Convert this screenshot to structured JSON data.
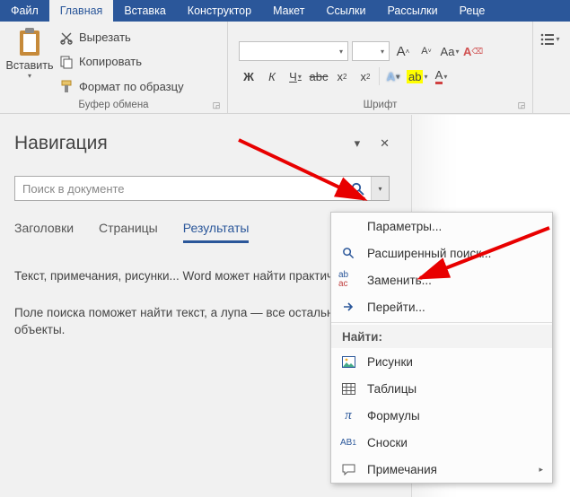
{
  "tabs": {
    "file": "Файл",
    "home": "Главная",
    "insert": "Вставка",
    "design": "Конструктор",
    "layout": "Макет",
    "refs": "Ссылки",
    "mail": "Рассылки",
    "review": "Реце"
  },
  "ribbon": {
    "clipboard": {
      "paste": "Вставить",
      "cut": "Вырезать",
      "copy": "Копировать",
      "format_painter": "Формат по образцу",
      "group_label": "Буфер обмена"
    },
    "font": {
      "group_label": "Шрифт"
    }
  },
  "nav": {
    "title": "Навигация",
    "search_placeholder": "Поиск в документе",
    "tabs": {
      "headings": "Заголовки",
      "pages": "Страницы",
      "results": "Результаты"
    },
    "body1": "Текст, примечания, рисунки... Word может найти практически все.",
    "body2": "Поле поиска поможет найти текст, а лупа — все остальные объекты."
  },
  "menu": {
    "options": "Параметры...",
    "adv_find": "Расширенный поиск...",
    "replace": "Заменить...",
    "goto": "Перейти...",
    "find_head": "Найти:",
    "pictures": "Рисунки",
    "tables": "Таблицы",
    "equations": "Формулы",
    "footnotes": "Сноски",
    "comments": "Примечания"
  }
}
